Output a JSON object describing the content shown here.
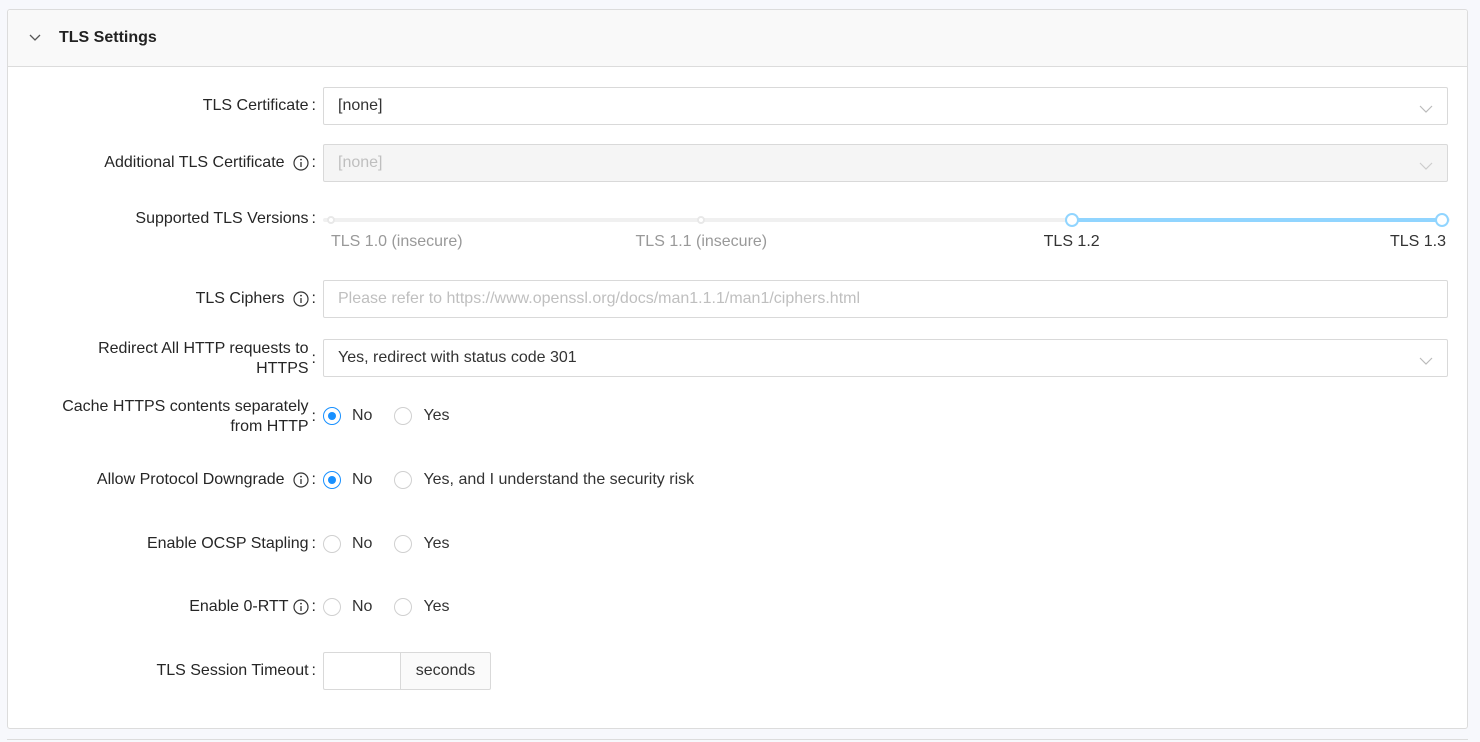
{
  "section": {
    "title": "TLS Settings",
    "toggle_icon": "chevron-down-icon"
  },
  "tls_certificate": {
    "label": "TLS Certificate",
    "value": "[none]"
  },
  "additional_tls_certificate": {
    "label": "Additional TLS Certificate",
    "value": "[none]",
    "disabled": true,
    "has_info": true
  },
  "supported_tls_versions": {
    "label": "Supported TLS Versions",
    "marks": [
      {
        "label": "TLS 1.0 (insecure)",
        "position": 0
      },
      {
        "label": "TLS 1.1 (insecure)",
        "position": 1
      },
      {
        "label": "TLS 1.2",
        "position": 2
      },
      {
        "label": "TLS 1.3",
        "position": 3
      }
    ],
    "min": 0,
    "max": 3,
    "selected_range": [
      2,
      3
    ],
    "accent_color": "#91d5ff"
  },
  "tls_ciphers": {
    "label": "TLS Ciphers",
    "value": "",
    "placeholder": "Please refer to https://www.openssl.org/docs/man1.1.1/man1/ciphers.html",
    "has_info": true
  },
  "redirect_http": {
    "label_line1": "Redirect All HTTP requests to",
    "label_line2": "HTTPS",
    "value": "Yes, redirect with status code 301"
  },
  "cache_https": {
    "label_line1": "Cache HTTPS contents separately",
    "label_line2": "from HTTP",
    "options": [
      "No",
      "Yes"
    ],
    "selected": "No"
  },
  "allow_downgrade": {
    "label": "Allow Protocol Downgrade",
    "has_info": true,
    "options": [
      "No",
      "Yes, and I understand the security risk"
    ],
    "selected": "No"
  },
  "ocsp_stapling": {
    "label": "Enable OCSP Stapling",
    "options": [
      "No",
      "Yes"
    ],
    "selected": null
  },
  "zero_rtt": {
    "label": "Enable 0-RTT",
    "has_info": true,
    "options": [
      "No",
      "Yes"
    ],
    "selected": null
  },
  "session_timeout": {
    "label": "TLS Session Timeout",
    "value": "",
    "unit": "seconds"
  },
  "colors": {
    "radio_checked": "#1890ff",
    "slider_active": "#91d5ff"
  },
  "colon": ":"
}
